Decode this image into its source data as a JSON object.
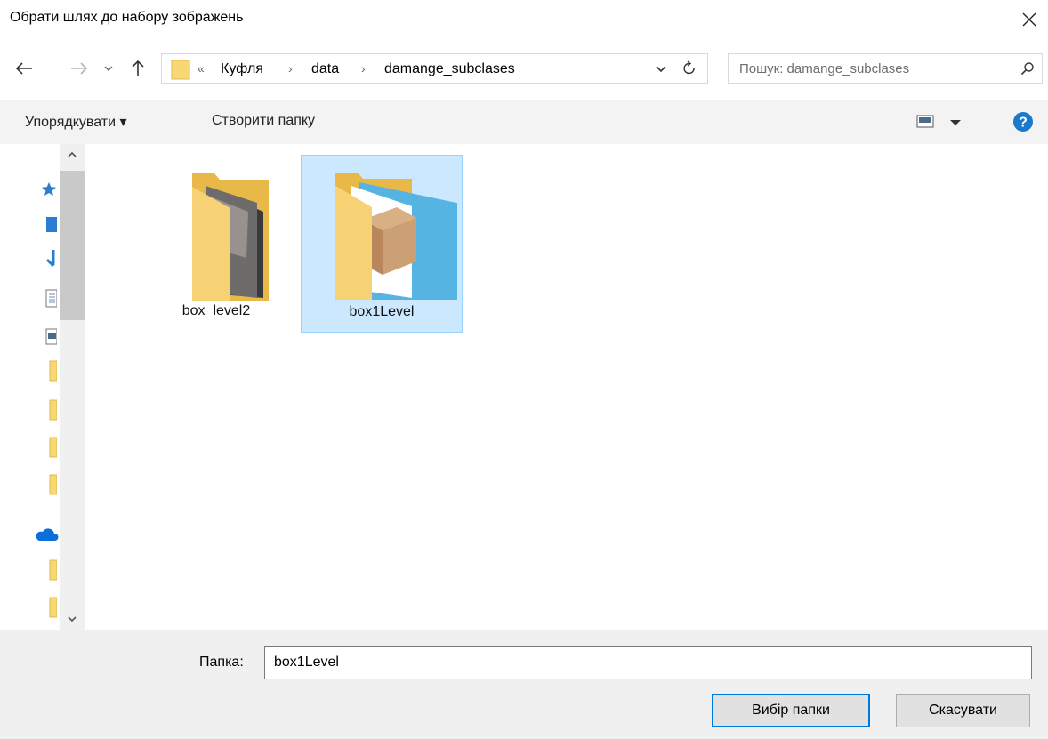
{
  "window": {
    "title": "Обрати шлях до набору зображень"
  },
  "address": {
    "overflow": "«",
    "crumbs": [
      "Куфля",
      "data",
      "damange_subclases"
    ],
    "separator": "›"
  },
  "search": {
    "placeholder": "Пошук: damange_subclases"
  },
  "toolbar": {
    "organize_label": "Упорядкувати ▾",
    "new_folder_label": "Створити папку"
  },
  "folders": [
    {
      "name": "box_level2",
      "selected": false
    },
    {
      "name": "box1Level",
      "selected": true
    }
  ],
  "bottom": {
    "folder_label": "Папка:",
    "folder_value": "box1Level",
    "select_button": "Вибір папки",
    "cancel_button": "Скасувати"
  },
  "colors": {
    "selection": "#cce8ff",
    "selection_border": "#99d1ff",
    "accent": "#0078d7",
    "folder": "#f8d775",
    "help": "#1979ca"
  },
  "icons": {
    "close": "close-icon",
    "back": "back-arrow-icon",
    "forward": "forward-arrow-icon",
    "recent": "recent-locations-chevron-icon",
    "up": "up-arrow-icon",
    "refresh": "refresh-icon",
    "search": "search-icon",
    "view": "view-options-icon",
    "help": "help-icon"
  }
}
